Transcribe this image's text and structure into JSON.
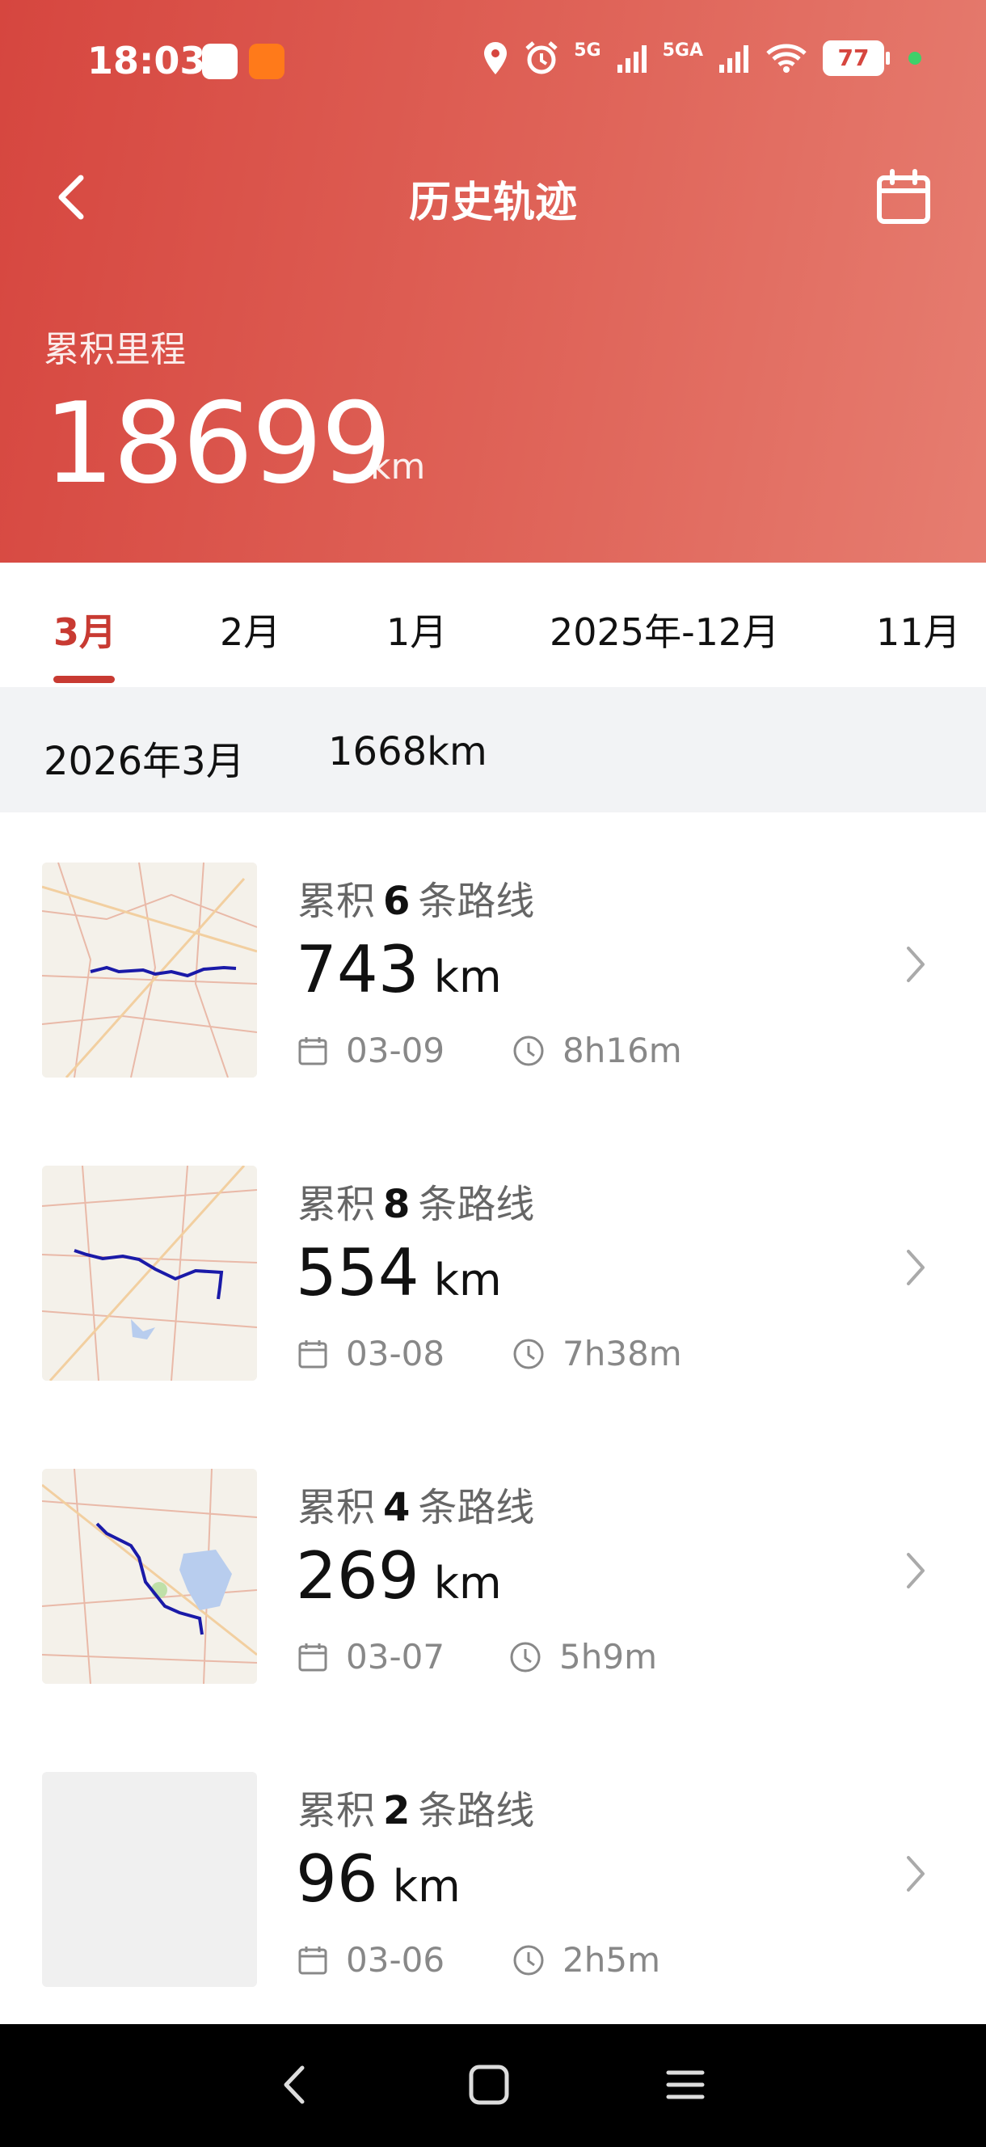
{
  "status_bar": {
    "time": "18:03",
    "network_labels": [
      "5G",
      "5GA"
    ],
    "battery": "77",
    "colors": {
      "app_badge_1": "#ffffff",
      "app_badge_2": "#ff7a1a",
      "privacy_dot": "#3fd06a"
    }
  },
  "header": {
    "title": "历史轨迹",
    "back_icon": "chevron-left-icon",
    "calendar_icon": "calendar-icon",
    "total_label": "累积里程",
    "total_value": "18699",
    "total_unit": "km",
    "colors": {
      "gradient_start": "#d6463f",
      "gradient_end": "#e67d70"
    }
  },
  "tabs": [
    {
      "label": "3月",
      "active": true
    },
    {
      "label": "2月",
      "active": false
    },
    {
      "label": "1月",
      "active": false
    },
    {
      "label": "2025年-12月",
      "active": false
    },
    {
      "label": "11月",
      "active": false
    }
  ],
  "accent_color": "#c83a32",
  "month_summary": {
    "month": "2026年3月",
    "distance": "1668km"
  },
  "trips": [
    {
      "prefix": "累积",
      "count": "6",
      "suffix": "条路线",
      "distance": "743",
      "unit": "km",
      "date": "03-09",
      "duration": "8h16m",
      "has_map": true
    },
    {
      "prefix": "累积",
      "count": "8",
      "suffix": "条路线",
      "distance": "554",
      "unit": "km",
      "date": "03-08",
      "duration": "7h38m",
      "has_map": true
    },
    {
      "prefix": "累积",
      "count": "4",
      "suffix": "条路线",
      "distance": "269",
      "unit": "km",
      "date": "03-07",
      "duration": "5h9m",
      "has_map": true
    },
    {
      "prefix": "累积",
      "count": "2",
      "suffix": "条路线",
      "distance": "96",
      "unit": "km",
      "date": "03-06",
      "duration": "2h5m",
      "has_map": false
    }
  ],
  "icons": {
    "date": "calendar-icon",
    "time": "clock-icon",
    "more": "chevron-right-icon"
  },
  "system_nav": {
    "icons": [
      "back-nav-icon",
      "home-nav-icon",
      "menu-nav-icon"
    ]
  }
}
